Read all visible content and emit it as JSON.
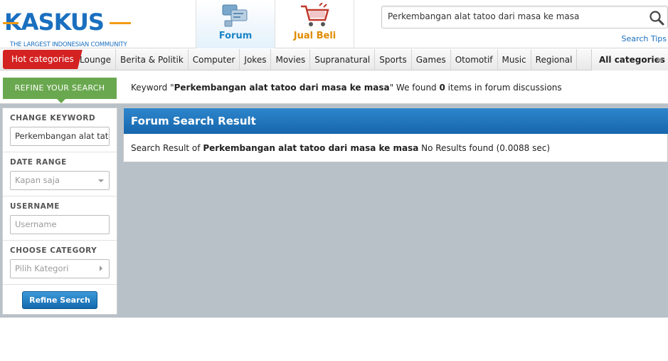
{
  "header": {
    "logo_text": "KASKUS",
    "tagline": "THE LARGEST INDONESIAN COMMUNITY",
    "tabs": [
      {
        "label": "Forum",
        "icon": "forum-icon"
      },
      {
        "label": "Jual Beli",
        "icon": "shopping-cart-icon"
      }
    ],
    "search": {
      "value": "Perkembangan alat tatoo dari masa ke masa",
      "icon": "search-icon"
    },
    "search_tips": "Search Tips"
  },
  "catbar": {
    "hot": "Hot categories",
    "items": [
      "Lounge",
      "Berita & Politik",
      "Computer",
      "Jokes",
      "Movies",
      "Supranatural",
      "Sports",
      "Games",
      "Otomotif",
      "Music",
      "Regional"
    ],
    "all": "All categories"
  },
  "refine": {
    "label": "REFINE YOUR SEARCH",
    "summary_prefix": "Keyword \"",
    "keyword": "Perkembangan alat tatoo dari masa ke masa",
    "summary_mid": "\" We found ",
    "count": "0",
    "summary_suffix": " items in forum discussions"
  },
  "sidebar": {
    "keyword_label": "CHANGE KEYWORD",
    "keyword_value": "Perkembangan alat tatoo dari masa ke masa",
    "date_label": "DATE RANGE",
    "date_value": "Kapan saja",
    "username_label": "USERNAME",
    "username_placeholder": "Username",
    "category_label": "CHOOSE CATEGORY",
    "category_value": "Pilih Kategori",
    "button": "Refine Search"
  },
  "results": {
    "title": "Forum Search Result",
    "prefix": "Search Result of ",
    "keyword": "Perkembangan alat tatoo dari masa ke masa",
    "suffix": " No Results found (0.0088 sec)"
  },
  "colors": {
    "brand_blue": "#1a84c8",
    "hot_red": "#d42121",
    "refine_green": "#6aa84f",
    "logo_orange": "#f39c12"
  }
}
